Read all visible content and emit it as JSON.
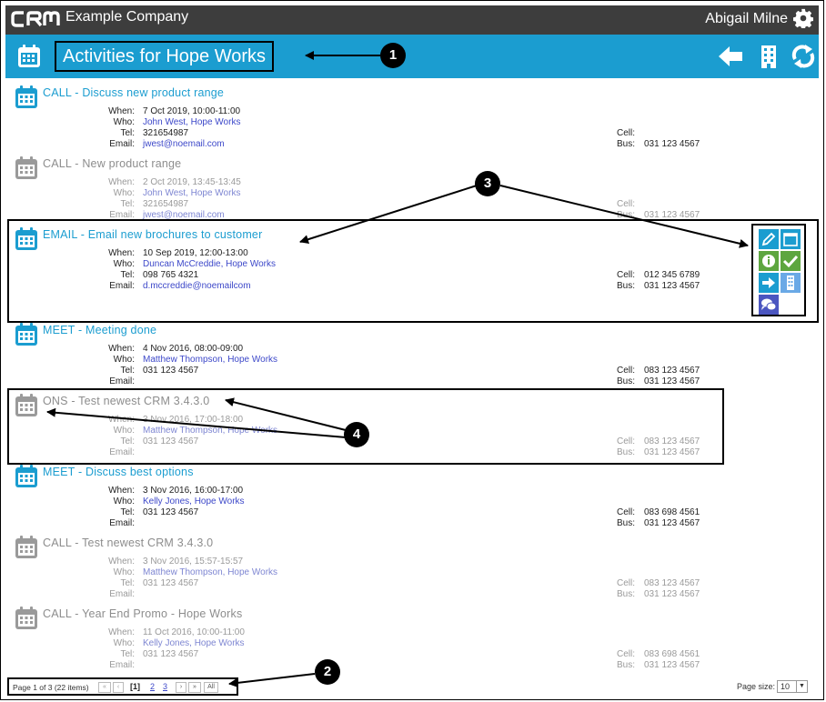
{
  "header": {
    "logo_text": "CRM",
    "company": "Example Company",
    "user": "Abigail Milne"
  },
  "title": "Activities for Hope Works",
  "labels": {
    "when": "When:",
    "who": "Who:",
    "tel": "Tel:",
    "email": "Email:",
    "cell": "Cell:",
    "bus": "Bus:"
  },
  "activities": [
    {
      "subject": "CALL - Discuss new product range",
      "when": "7 Oct 2019, 10:00-11:00",
      "who": "John West, Hope Works",
      "tel": "321654987",
      "email": "jwest@noemail.com",
      "cell": "",
      "bus": "031 123 4567"
    },
    {
      "subject": "CALL - New product range",
      "when": "2 Oct 2019, 13:45-13:45",
      "who": "John West, Hope Works",
      "tel": "321654987",
      "email": "jwest@noemail.com",
      "cell": "",
      "bus": "031 123 4567"
    },
    {
      "subject": "EMAIL - Email new brochures to customer",
      "when": "10 Sep 2019, 12:00-13:00",
      "who": "Duncan McCreddie, Hope Works",
      "tel": "098 765 4321",
      "email": "d.mccreddie@noemailcom",
      "cell": "012 345 6789",
      "bus": "031 123 4567"
    },
    {
      "subject": "MEET - Meeting done",
      "when": "4 Nov 2016, 08:00-09:00",
      "who": "Matthew Thompson, Hope Works",
      "tel": "031 123 4567",
      "email": "",
      "cell": "083 123 4567",
      "bus": "031 123 4567"
    },
    {
      "subject": "ONS - Test newest CRM 3.4.3.0",
      "when": "3 Nov 2016, 17:00-18:00",
      "who": "Matthew Thompson, Hope Works",
      "tel": "031 123 4567",
      "email": "",
      "cell": "083 123 4567",
      "bus": "031 123 4567"
    },
    {
      "subject": "MEET - Discuss best options",
      "when": "3 Nov 2016, 16:00-17:00",
      "who": "Kelly Jones, Hope Works",
      "tel": "031 123 4567",
      "email": "",
      "cell": "083 698 4561",
      "bus": "031 123 4567"
    },
    {
      "subject": "CALL - Test newest CRM 3.4.3.0",
      "when": "3 Nov 2016, 15:57-15:57",
      "who": "Matthew Thompson, Hope Works",
      "tel": "031 123 4567",
      "email": "",
      "cell": "083 123 4567",
      "bus": "031 123 4567"
    },
    {
      "subject": "CALL - Year End Promo - Hope Works",
      "when": "11 Oct 2016, 10:00-11:00",
      "who": "Kelly Jones, Hope Works",
      "tel": "031 123 4567",
      "email": "",
      "cell": "083 698 4561",
      "bus": "031 123 4567"
    }
  ],
  "pager": {
    "summary": "Page 1 of 3 (22 items)",
    "first": "«",
    "prev": "‹",
    "current": "[1]",
    "page2": "2",
    "page3": "3",
    "next": "›",
    "last": "»",
    "all": "All"
  },
  "page_size": {
    "label": "Page size:",
    "value": "10"
  },
  "callouts": [
    "1",
    "2",
    "3",
    "4"
  ],
  "colors": {
    "topbar": "#3d3d3d",
    "titlebar": "#1b9dd0",
    "link": "#3d48c9",
    "icon_blue": "#1b9dd0",
    "icon_green": "#5da63f",
    "icon_purple": "#4b56c0",
    "inactive": "#9a9a9a"
  }
}
